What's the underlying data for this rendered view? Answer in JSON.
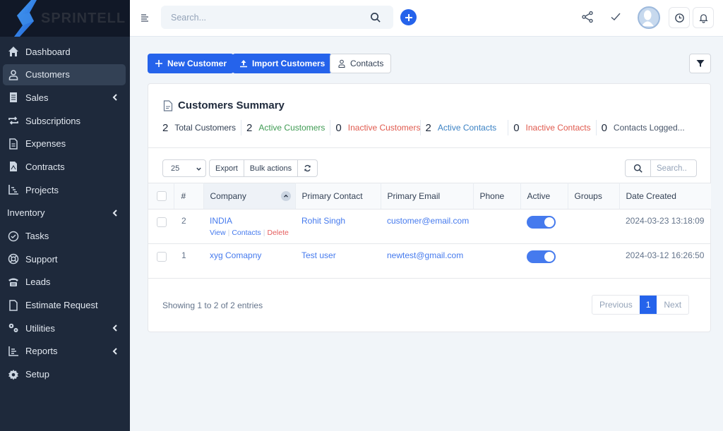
{
  "brand": {
    "name": "SPRINTELL"
  },
  "sidebar": {
    "items": [
      {
        "label": "Dashboard",
        "icon": "home-icon",
        "active": false,
        "has_submenu": false
      },
      {
        "label": "Customers",
        "icon": "user-icon",
        "active": true,
        "has_submenu": false
      },
      {
        "label": "Sales",
        "icon": "receipt-icon",
        "active": false,
        "has_submenu": true
      },
      {
        "label": "Subscriptions",
        "icon": "repeat-icon",
        "active": false,
        "has_submenu": false
      },
      {
        "label": "Expenses",
        "icon": "document-icon",
        "active": false,
        "has_submenu": false
      },
      {
        "label": "Contracts",
        "icon": "contract-icon",
        "active": false,
        "has_submenu": false
      },
      {
        "label": "Projects",
        "icon": "chart-icon",
        "active": false,
        "has_submenu": false
      },
      {
        "label": "Inventory",
        "icon": "",
        "active": false,
        "has_submenu": true
      },
      {
        "label": "Tasks",
        "icon": "check-circle-icon",
        "active": false,
        "has_submenu": false
      },
      {
        "label": "Support",
        "icon": "lifebuoy-icon",
        "active": false,
        "has_submenu": false
      },
      {
        "label": "Leads",
        "icon": "phone-icon",
        "active": false,
        "has_submenu": false
      },
      {
        "label": "Estimate Request",
        "icon": "file-icon",
        "active": false,
        "has_submenu": false
      },
      {
        "label": "Utilities",
        "icon": "cogs-icon",
        "active": false,
        "has_submenu": true
      },
      {
        "label": "Reports",
        "icon": "bar-chart-icon",
        "active": false,
        "has_submenu": true
      },
      {
        "label": "Setup",
        "icon": "gear-icon",
        "active": false,
        "has_submenu": false
      }
    ]
  },
  "header": {
    "search_placeholder": "Search...",
    "icons": [
      "menu-icon",
      "search-icon",
      "plus-icon",
      "share-icon",
      "check-icon",
      "avatar",
      "clock-icon",
      "bell-icon"
    ]
  },
  "actions": {
    "new_customer": "New Customer",
    "import_customers": "Import Customers",
    "contacts": "Contacts"
  },
  "summary": {
    "title": "Customers Summary",
    "stats": [
      {
        "value": "2",
        "label": "Total Customers",
        "color": "#334155"
      },
      {
        "value": "2",
        "label": "Active Customers",
        "color": "#16a34a"
      },
      {
        "value": "0",
        "label": "Inactive Customers",
        "color": "#dc2626"
      },
      {
        "value": "2",
        "label": "Active Contacts",
        "color": "#2563eb"
      },
      {
        "value": "0",
        "label": "Inactive Contacts",
        "color": "#dc2626"
      },
      {
        "value": "0",
        "label": "Contacts Logged...",
        "color": "#475569"
      }
    ]
  },
  "table_tools": {
    "page_size": "25",
    "export": "Export",
    "bulk_actions": "Bulk actions",
    "search_placeholder": "Search.."
  },
  "table": {
    "columns": [
      "#",
      "Company",
      "Primary Contact",
      "Primary Email",
      "Phone",
      "Active",
      "Groups",
      "Date Created"
    ],
    "rows": [
      {
        "id": "2",
        "company": "INDIA",
        "contact": "Rohit Singh",
        "email": "customer@email.com",
        "phone": "",
        "active": true,
        "groups": "",
        "date": "2024-03-23 13:18:09",
        "actions": [
          "View",
          "Contacts",
          "Delete"
        ]
      },
      {
        "id": "1",
        "company": "xyg Comapny",
        "contact": "Test user",
        "email": "newtest@gmail.com",
        "phone": "",
        "active": true,
        "groups": "",
        "date": "2024-03-12 16:26:50",
        "actions": []
      }
    ]
  },
  "footer": {
    "showing": "Showing 1 to 2 of 2 entries",
    "previous": "Previous",
    "current_page": "1",
    "next": "Next"
  },
  "colors": {
    "accent": "#2563eb",
    "sidebar_bg": "#1e293b",
    "active_green": "#16a34a",
    "danger": "#dc2626"
  }
}
